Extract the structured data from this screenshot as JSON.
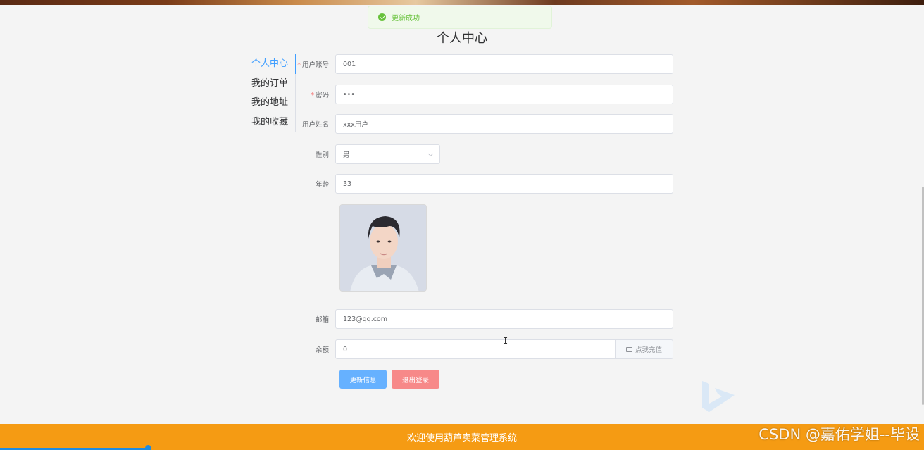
{
  "toast": {
    "text": "更新成功",
    "icon": "success-check-icon",
    "color": "#67c23a"
  },
  "page_title": "个人中心",
  "side_menu": {
    "items": [
      {
        "label": "个人中心",
        "active": true
      },
      {
        "label": "我的订单",
        "active": false
      },
      {
        "label": "我的地址",
        "active": false
      },
      {
        "label": "我的收藏",
        "active": false
      }
    ]
  },
  "form": {
    "account": {
      "label": "用户账号",
      "value": "001",
      "required": true
    },
    "password": {
      "label": "密码",
      "value": "•••",
      "required": true
    },
    "name": {
      "label": "用户姓名",
      "value": "xxx用户"
    },
    "gender": {
      "label": "性别",
      "value": "男"
    },
    "age": {
      "label": "年龄",
      "value": "33"
    },
    "email": {
      "label": "邮箱",
      "value": "123@qq.com"
    },
    "balance": {
      "label": "余额",
      "value": "0",
      "append": "点我充值",
      "append_icon": "wallet-icon"
    }
  },
  "buttons": {
    "update": "更新信息",
    "logout": "退出登录"
  },
  "footer": {
    "text": "欢迎使用葫芦卖菜管理系统",
    "color": "#f59b13"
  },
  "watermark": "CSDN @嘉佑学姐--毕设",
  "colors": {
    "primary": "#409eff",
    "danger": "#f56c6c",
    "success": "#67c23a"
  },
  "video_progress": 0.16
}
